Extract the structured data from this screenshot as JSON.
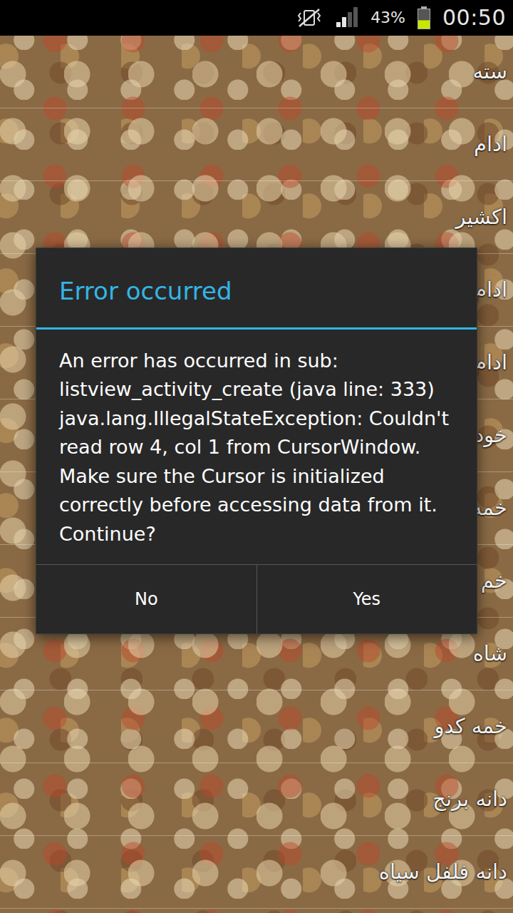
{
  "status_bar": {
    "vibrate_off_icon": true,
    "signal": {
      "level": 0.5
    },
    "battery": {
      "percent": "43%",
      "level": 0.43
    },
    "time": "00:50"
  },
  "list": {
    "items": [
      {
        "label": "سته"
      },
      {
        "label": "ادام"
      },
      {
        "label": "اکشیر"
      },
      {
        "label": "ادام"
      },
      {
        "label": "ادام"
      },
      {
        "label": "خود"
      },
      {
        "label": "خمه"
      },
      {
        "label": "خم"
      },
      {
        "label": "شاه"
      },
      {
        "label": "خمه کدو"
      },
      {
        "label": "دانه برنج"
      },
      {
        "label": "دانه فلفل سیاه"
      }
    ]
  },
  "dialog": {
    "title": "Error occurred",
    "message": "An error has occurred in sub: listview_activity_create (java line: 333) java.lang.IllegalStateException: Couldn't read row 4, col 1 from CursorWindow.  Make sure the Cursor is initialized correctly before accessing data from it. Continue?",
    "buttons": [
      {
        "label": "No"
      },
      {
        "label": "Yes"
      }
    ]
  }
}
